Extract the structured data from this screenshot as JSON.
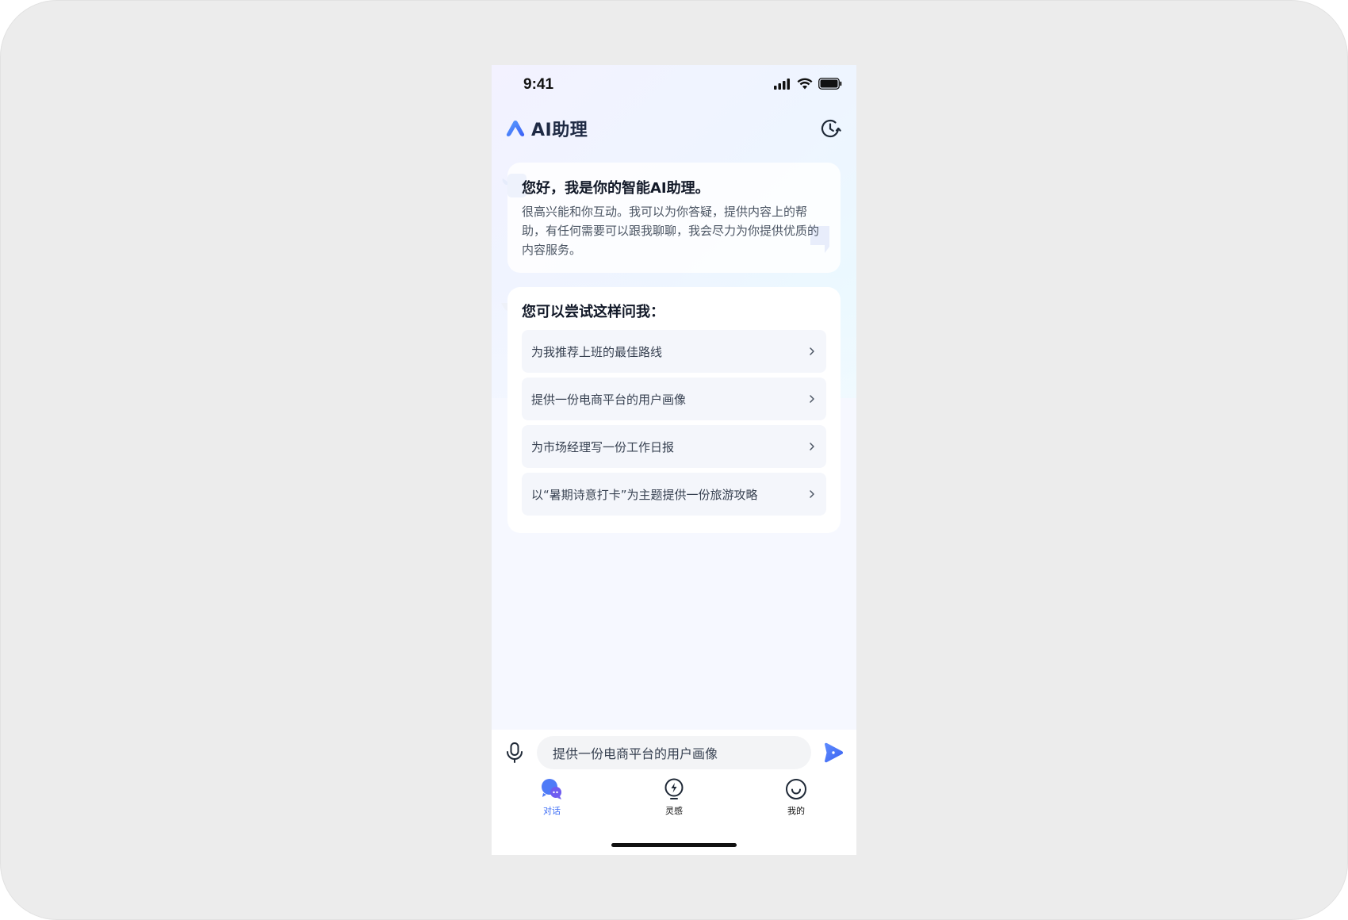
{
  "status_bar": {
    "time": "9:41"
  },
  "header": {
    "title": "AI助理"
  },
  "welcome": {
    "title": "您好，我是你的智能AI助理。",
    "body": "很高兴能和你互动。我可以为你答疑，提供内容上的帮助，有任何需要可以跟我聊聊，我会尽力为你提供优质的内容服务。"
  },
  "suggestions": {
    "title": "您可以尝试这样问我：",
    "items": [
      {
        "label": "为我推荐上班的最佳路线"
      },
      {
        "label": "提供一份电商平台的用户画像"
      },
      {
        "label": "为市场经理写一份工作日报"
      },
      {
        "label": "以“暑期诗意打卡”为主题提供一份旅游攻略"
      }
    ]
  },
  "input": {
    "value": "提供一份电商平台的用户画像"
  },
  "tabs": [
    {
      "label": "对话",
      "icon": "chat-bubbles-icon",
      "active": true
    },
    {
      "label": "灵感",
      "icon": "lightning-bulb-icon",
      "active": false
    },
    {
      "label": "我的",
      "icon": "smile-face-icon",
      "active": false
    }
  ],
  "colors": {
    "accent": "#3b6cf6",
    "background": "#ececec",
    "card": "#ffffff",
    "suggestion_bg": "#f4f6fb"
  }
}
